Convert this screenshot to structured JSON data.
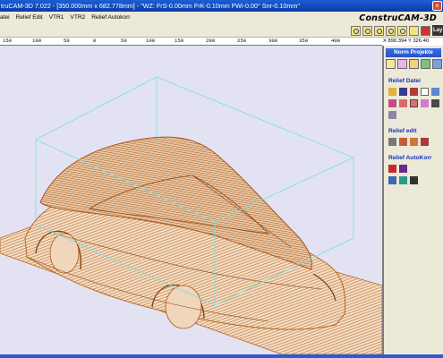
{
  "window": {
    "title": "truCAM-3D 7.022 - [350.000mm x 682.778mm] - \"WZ: FrS-0.00mm FrK-0.10mm FWi-0.00° Snr-0.10mm\"",
    "close_glyph": "×"
  },
  "menu": {
    "items": [
      "atei",
      "Relief Edit",
      "VTR1",
      "VTR2",
      "Relief Autokorr"
    ],
    "brand": "ConstruCAM-3D"
  },
  "toolbar": {
    "layer_label": "Lay"
  },
  "ruler": {
    "ticks": [
      "150",
      "100",
      "50",
      "0",
      "50",
      "100",
      "150",
      "200",
      "250",
      "300",
      "350",
      "400"
    ]
  },
  "status": {
    "coord_x": "X 890.394",
    "coord_y": "Y 326.40"
  },
  "panel": {
    "header": "Norm Projekte",
    "sections": [
      "Relief Datei",
      "Relief edit",
      "Relief AutoKorr"
    ]
  },
  "colors": {
    "model_brown": "#b8651e",
    "viewport_bg": "#e3e2f3",
    "bbox_cyan": "#7fe0e0",
    "titlebar_blue": "#0a3aa6",
    "section_blue": "#1830b8"
  },
  "icons": {
    "toolbar": [
      "zoom-in-icon",
      "zoom-out-icon",
      "zoom-window-icon",
      "zoom-all-icon",
      "zoom-prev-icon",
      "zoom-next-icon",
      "grid-icon",
      "layer-icon"
    ],
    "panel_tabs": [
      "folder-icon",
      "relief-icon",
      "edit-icon",
      "layers-icon",
      "tool-icon"
    ]
  }
}
